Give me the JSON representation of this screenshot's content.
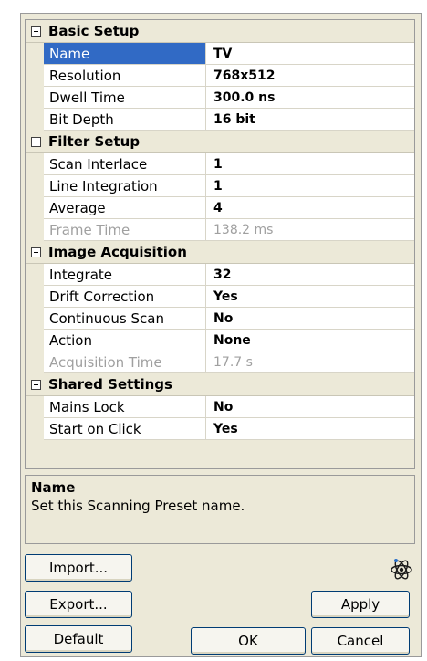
{
  "sections": [
    {
      "title": "Basic Setup",
      "rows": [
        {
          "label": "Name",
          "value": "TV",
          "selected": true
        },
        {
          "label": "Resolution",
          "value": "768x512"
        },
        {
          "label": "Dwell Time",
          "value": "300.0 ns"
        },
        {
          "label": "Bit Depth",
          "value": "16 bit"
        }
      ]
    },
    {
      "title": "Filter Setup",
      "rows": [
        {
          "label": "Scan Interlace",
          "value": "1"
        },
        {
          "label": "Line Integration",
          "value": "1"
        },
        {
          "label": "Average",
          "value": "4"
        },
        {
          "label": "Frame Time",
          "value": "138.2 ms",
          "disabled": true
        }
      ]
    },
    {
      "title": "Image Acquisition",
      "rows": [
        {
          "label": "Integrate",
          "value": "32"
        },
        {
          "label": "Drift Correction",
          "value": "Yes"
        },
        {
          "label": "Continuous Scan",
          "value": "No"
        },
        {
          "label": "Action",
          "value": "None"
        },
        {
          "label": "Acquisition Time",
          "value": "17.7 s",
          "disabled": true
        }
      ]
    },
    {
      "title": "Shared Settings",
      "rows": [
        {
          "label": "Mains Lock",
          "value": "No"
        },
        {
          "label": "Start on Click",
          "value": "Yes"
        }
      ]
    }
  ],
  "description": {
    "title": "Name",
    "text": "Set this Scanning Preset name."
  },
  "buttons": {
    "import": "Import...",
    "export": "Export...",
    "default": "Default",
    "apply": "Apply",
    "ok": "OK",
    "cancel": "Cancel"
  },
  "icons": {
    "logo": "atom-icon",
    "section_toggle": "collapse-minus-icon"
  },
  "colors": {
    "selection": "#316ac5",
    "panel_bg": "#ece9d8",
    "disabled_text": "#a0a0a0",
    "button_border": "#003c74"
  }
}
